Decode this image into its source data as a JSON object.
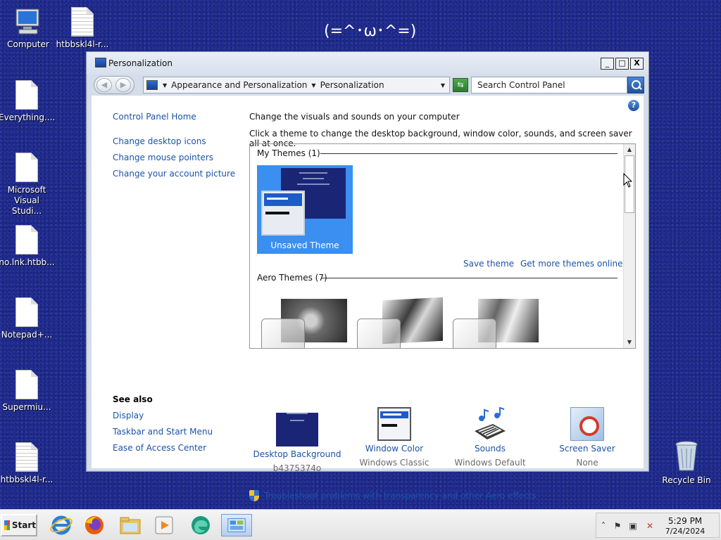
{
  "desktop": {
    "kaomoji": "(=^･ω･^=)",
    "icons": [
      {
        "label": "Computer",
        "icon": "computer-icon"
      },
      {
        "label": "htbbskl4l-r...",
        "icon": "text-file-icon"
      },
      {
        "label": "Everything....",
        "icon": "file-icon"
      },
      {
        "label": "Microsoft Visual Studi...",
        "icon": "file-icon"
      },
      {
        "label": "no.lnk.htbb...",
        "icon": "file-icon"
      },
      {
        "label": "Notepad+...",
        "icon": "file-icon"
      },
      {
        "label": "Supermiu...",
        "icon": "file-icon"
      },
      {
        "label": "htbbskl4l-r...",
        "icon": "text-file-icon"
      },
      {
        "label": "Recycle Bin",
        "icon": "recycle-bin-icon"
      }
    ]
  },
  "window": {
    "title": "Personalization",
    "controls": {
      "minimize": "_",
      "maximize": "□",
      "close": "X"
    },
    "breadcrumb": [
      "Appearance and Personalization",
      "Personalization"
    ],
    "search_placeholder": "Search Control Panel",
    "sidebar": {
      "home": "Control Panel Home",
      "links": [
        "Change desktop icons",
        "Change mouse pointers",
        "Change your account picture"
      ],
      "see_also_title": "See also",
      "see_also": [
        "Display",
        "Taskbar and Start Menu",
        "Ease of Access Center"
      ]
    },
    "heading": "Change the visuals and sounds on your computer",
    "subheading": "Click a theme to change the desktop background, window color, sounds, and screen saver all at once.",
    "themes": {
      "my_themes_title": "My Themes (1)",
      "unsaved_theme": "Unsaved Theme",
      "save_theme": "Save theme",
      "get_more": "Get more themes online",
      "aero_themes_title": "Aero Themes (7)"
    },
    "bottom": [
      {
        "label": "Desktop Background",
        "value": "b4375374o"
      },
      {
        "label": "Window Color",
        "value": "Windows Classic"
      },
      {
        "label": "Sounds",
        "value": "Windows Default"
      },
      {
        "label": "Screen Saver",
        "value": "None"
      }
    ],
    "troubleshoot": "Troubleshoot problems with transparency and other Aero effects"
  },
  "taskbar": {
    "start": "Start",
    "apps": [
      "internet-explorer-icon",
      "firefox-icon",
      "file-explorer-icon",
      "media-player-icon",
      "edge-icon",
      "control-panel-icon"
    ],
    "clock": {
      "time": "5:29 PM",
      "date": "7/24/2024"
    }
  },
  "colors": {
    "desktop": "#1e2a8f",
    "link": "#1a53a8",
    "selection": "#3a8ff0"
  }
}
